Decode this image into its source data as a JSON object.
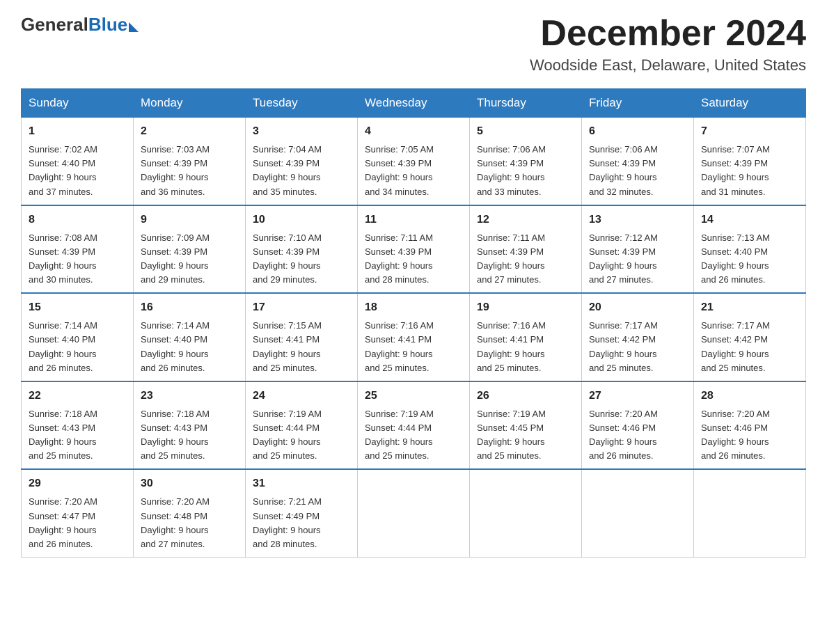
{
  "header": {
    "logo_general": "General",
    "logo_blue": "Blue",
    "month_title": "December 2024",
    "location": "Woodside East, Delaware, United States"
  },
  "weekdays": [
    "Sunday",
    "Monday",
    "Tuesday",
    "Wednesday",
    "Thursday",
    "Friday",
    "Saturday"
  ],
  "weeks": [
    [
      {
        "day": "1",
        "info": "Sunrise: 7:02 AM\nSunset: 4:40 PM\nDaylight: 9 hours\nand 37 minutes."
      },
      {
        "day": "2",
        "info": "Sunrise: 7:03 AM\nSunset: 4:39 PM\nDaylight: 9 hours\nand 36 minutes."
      },
      {
        "day": "3",
        "info": "Sunrise: 7:04 AM\nSunset: 4:39 PM\nDaylight: 9 hours\nand 35 minutes."
      },
      {
        "day": "4",
        "info": "Sunrise: 7:05 AM\nSunset: 4:39 PM\nDaylight: 9 hours\nand 34 minutes."
      },
      {
        "day": "5",
        "info": "Sunrise: 7:06 AM\nSunset: 4:39 PM\nDaylight: 9 hours\nand 33 minutes."
      },
      {
        "day": "6",
        "info": "Sunrise: 7:06 AM\nSunset: 4:39 PM\nDaylight: 9 hours\nand 32 minutes."
      },
      {
        "day": "7",
        "info": "Sunrise: 7:07 AM\nSunset: 4:39 PM\nDaylight: 9 hours\nand 31 minutes."
      }
    ],
    [
      {
        "day": "8",
        "info": "Sunrise: 7:08 AM\nSunset: 4:39 PM\nDaylight: 9 hours\nand 30 minutes."
      },
      {
        "day": "9",
        "info": "Sunrise: 7:09 AM\nSunset: 4:39 PM\nDaylight: 9 hours\nand 29 minutes."
      },
      {
        "day": "10",
        "info": "Sunrise: 7:10 AM\nSunset: 4:39 PM\nDaylight: 9 hours\nand 29 minutes."
      },
      {
        "day": "11",
        "info": "Sunrise: 7:11 AM\nSunset: 4:39 PM\nDaylight: 9 hours\nand 28 minutes."
      },
      {
        "day": "12",
        "info": "Sunrise: 7:11 AM\nSunset: 4:39 PM\nDaylight: 9 hours\nand 27 minutes."
      },
      {
        "day": "13",
        "info": "Sunrise: 7:12 AM\nSunset: 4:39 PM\nDaylight: 9 hours\nand 27 minutes."
      },
      {
        "day": "14",
        "info": "Sunrise: 7:13 AM\nSunset: 4:40 PM\nDaylight: 9 hours\nand 26 minutes."
      }
    ],
    [
      {
        "day": "15",
        "info": "Sunrise: 7:14 AM\nSunset: 4:40 PM\nDaylight: 9 hours\nand 26 minutes."
      },
      {
        "day": "16",
        "info": "Sunrise: 7:14 AM\nSunset: 4:40 PM\nDaylight: 9 hours\nand 26 minutes."
      },
      {
        "day": "17",
        "info": "Sunrise: 7:15 AM\nSunset: 4:41 PM\nDaylight: 9 hours\nand 25 minutes."
      },
      {
        "day": "18",
        "info": "Sunrise: 7:16 AM\nSunset: 4:41 PM\nDaylight: 9 hours\nand 25 minutes."
      },
      {
        "day": "19",
        "info": "Sunrise: 7:16 AM\nSunset: 4:41 PM\nDaylight: 9 hours\nand 25 minutes."
      },
      {
        "day": "20",
        "info": "Sunrise: 7:17 AM\nSunset: 4:42 PM\nDaylight: 9 hours\nand 25 minutes."
      },
      {
        "day": "21",
        "info": "Sunrise: 7:17 AM\nSunset: 4:42 PM\nDaylight: 9 hours\nand 25 minutes."
      }
    ],
    [
      {
        "day": "22",
        "info": "Sunrise: 7:18 AM\nSunset: 4:43 PM\nDaylight: 9 hours\nand 25 minutes."
      },
      {
        "day": "23",
        "info": "Sunrise: 7:18 AM\nSunset: 4:43 PM\nDaylight: 9 hours\nand 25 minutes."
      },
      {
        "day": "24",
        "info": "Sunrise: 7:19 AM\nSunset: 4:44 PM\nDaylight: 9 hours\nand 25 minutes."
      },
      {
        "day": "25",
        "info": "Sunrise: 7:19 AM\nSunset: 4:44 PM\nDaylight: 9 hours\nand 25 minutes."
      },
      {
        "day": "26",
        "info": "Sunrise: 7:19 AM\nSunset: 4:45 PM\nDaylight: 9 hours\nand 25 minutes."
      },
      {
        "day": "27",
        "info": "Sunrise: 7:20 AM\nSunset: 4:46 PM\nDaylight: 9 hours\nand 26 minutes."
      },
      {
        "day": "28",
        "info": "Sunrise: 7:20 AM\nSunset: 4:46 PM\nDaylight: 9 hours\nand 26 minutes."
      }
    ],
    [
      {
        "day": "29",
        "info": "Sunrise: 7:20 AM\nSunset: 4:47 PM\nDaylight: 9 hours\nand 26 minutes."
      },
      {
        "day": "30",
        "info": "Sunrise: 7:20 AM\nSunset: 4:48 PM\nDaylight: 9 hours\nand 27 minutes."
      },
      {
        "day": "31",
        "info": "Sunrise: 7:21 AM\nSunset: 4:49 PM\nDaylight: 9 hours\nand 28 minutes."
      },
      {
        "day": "",
        "info": ""
      },
      {
        "day": "",
        "info": ""
      },
      {
        "day": "",
        "info": ""
      },
      {
        "day": "",
        "info": ""
      }
    ]
  ]
}
